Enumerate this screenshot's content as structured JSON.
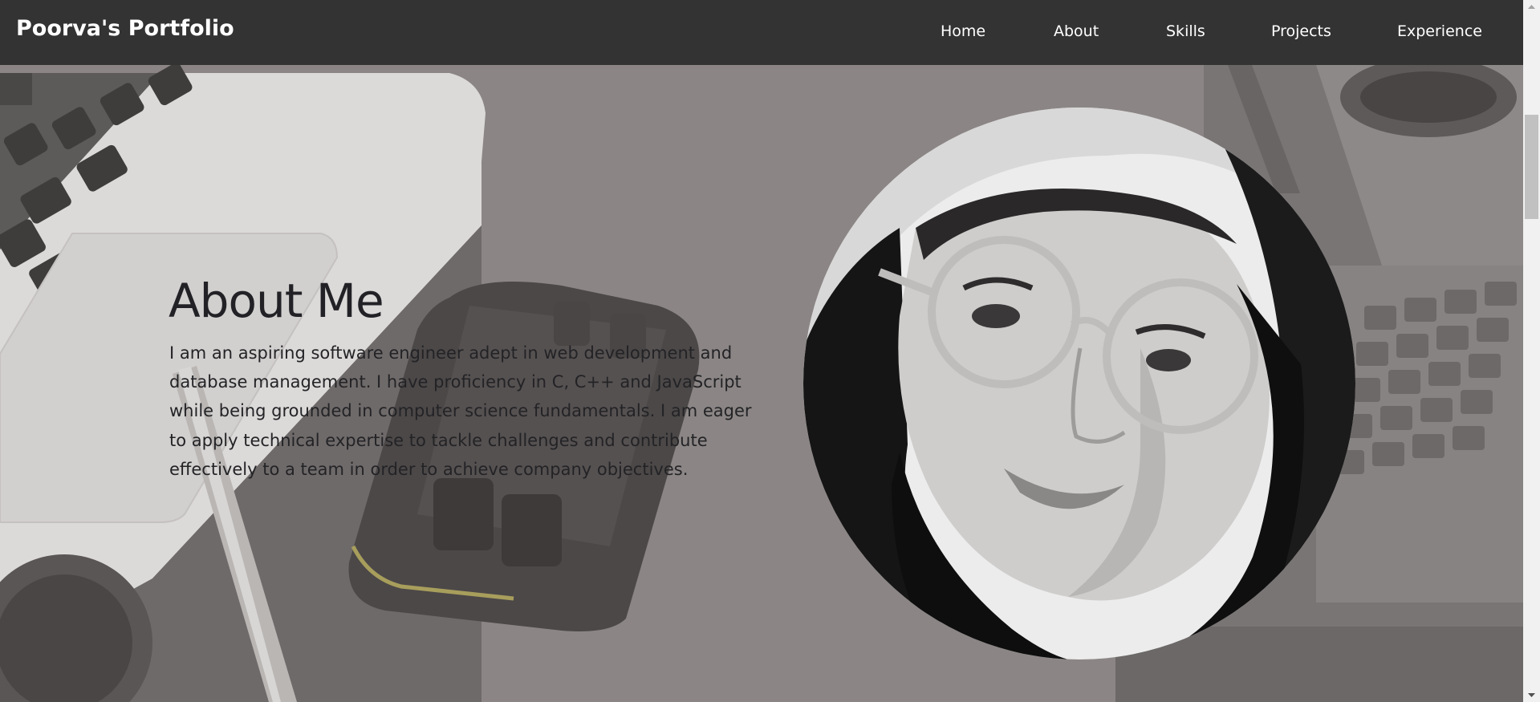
{
  "navbar": {
    "brand": "Poorva's Portfolio",
    "links": [
      {
        "label": "Home"
      },
      {
        "label": "About"
      },
      {
        "label": "Skills"
      },
      {
        "label": "Projects"
      },
      {
        "label": "Experience"
      }
    ]
  },
  "about": {
    "title": "About Me",
    "text": "I am an aspiring software engineer adept in web development and database management. I have proficiency in C, C++ and JavaScript while being grounded in computer science fundamentals. I am eager to apply technical expertise to tackle challenges and contribute effectively to a team in order to achieve company objectives."
  },
  "colors": {
    "navbar_bg": "#333333",
    "nav_text": "#ffffff",
    "overlay_bg": "#8a8584",
    "heading_text": "#222226"
  },
  "icons": {
    "profile_photo": "portrait-photo",
    "scroll_up": "triangle-up-icon",
    "scroll_down": "triangle-down-icon"
  }
}
